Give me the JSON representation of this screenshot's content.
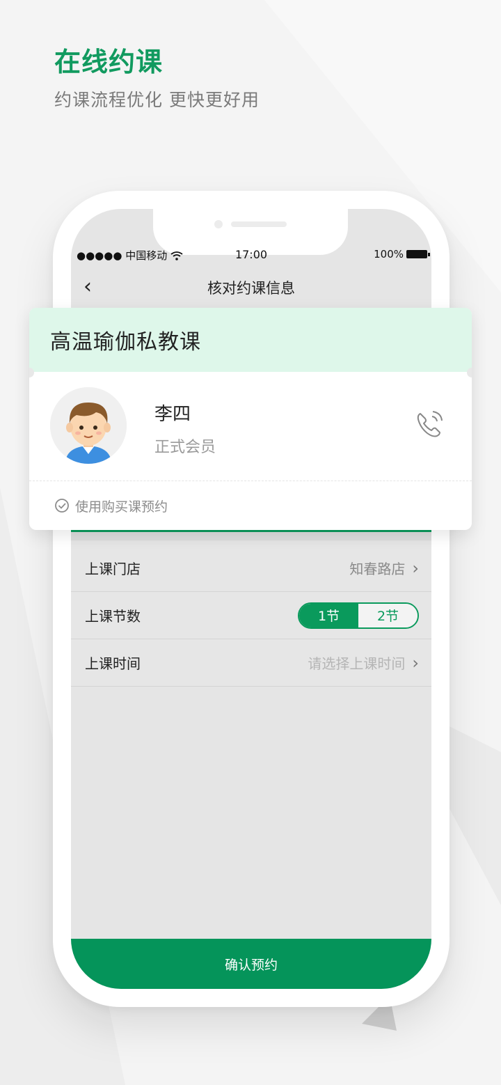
{
  "promo": {
    "headline": "在线约课",
    "subline": "约课流程优化 更快更好用"
  },
  "status_bar": {
    "carrier": "●●●●● 中国移动",
    "time": "17:00",
    "battery": "100%"
  },
  "navbar": {
    "back_icon": "‹",
    "title": "核对约课信息"
  },
  "course_card": {
    "course_name": "高温瑜伽私教课",
    "member_name": "李四",
    "member_level": "正式会员",
    "payment_option": "使用购买课预约"
  },
  "form": {
    "store": {
      "label": "上课门店",
      "value": "知春路店"
    },
    "sessions": {
      "label": "上课节数",
      "options": [
        "1节",
        "2节"
      ],
      "selected": "1节"
    },
    "time": {
      "label": "上课时间",
      "placeholder": "请选择上课时间"
    }
  },
  "confirm_button": "确认预约",
  "colors": {
    "accent": "#0a9a5c",
    "card_header_bg": "#def7ea"
  }
}
